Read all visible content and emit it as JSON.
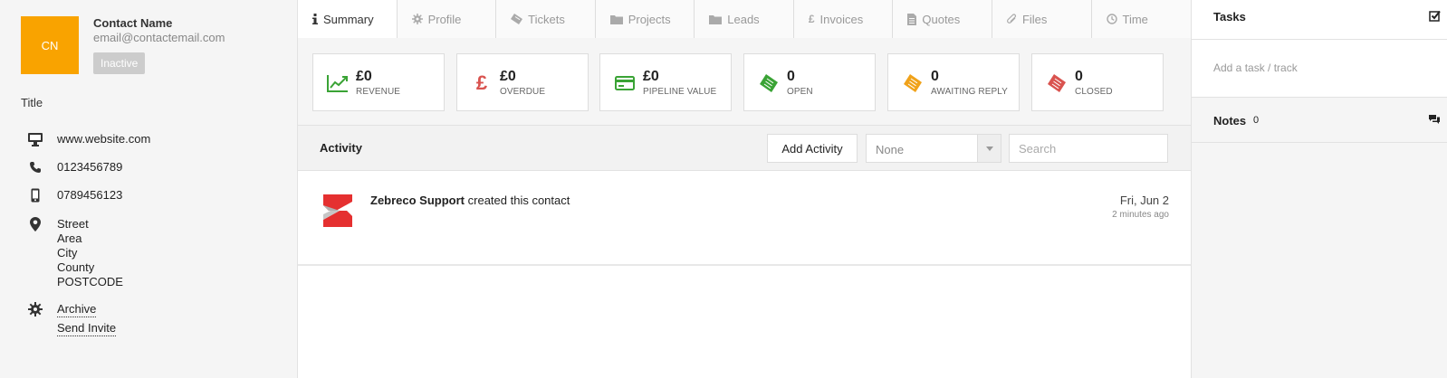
{
  "contact": {
    "initials": "CN",
    "name": "Contact Name",
    "email": "email@contactemail.com",
    "status": "Inactive",
    "title": "Title",
    "website": "www.website.com",
    "phone": "0123456789",
    "mobile": "0789456123",
    "address": [
      "Street",
      "Area",
      "City",
      "County",
      "POSTCODE"
    ],
    "actions": {
      "archive": "Archive",
      "send_invite": "Send Invite"
    },
    "avatar_color": "#f9a300"
  },
  "tabs": [
    {
      "label": "Summary",
      "icon": "info-icon",
      "active": true
    },
    {
      "label": "Profile",
      "icon": "gear-icon"
    },
    {
      "label": "Tickets",
      "icon": "ticket-icon"
    },
    {
      "label": "Projects",
      "icon": "folder-icon"
    },
    {
      "label": "Leads",
      "icon": "folder-icon"
    },
    {
      "label": "Invoices",
      "icon": "pound-icon"
    },
    {
      "label": "Quotes",
      "icon": "document-icon"
    },
    {
      "label": "Files",
      "icon": "paperclip-icon"
    },
    {
      "label": "Time",
      "icon": "clock-icon"
    }
  ],
  "stats": [
    {
      "value": "£0",
      "label": "REVENUE",
      "icon": "trend-up-icon",
      "color": "#3aa335"
    },
    {
      "value": "£0",
      "label": "OVERDUE",
      "icon": "pound-icon",
      "color": "#d9534f"
    },
    {
      "value": "£0",
      "label": "PIPELINE VALUE",
      "icon": "credit-card-icon",
      "color": "#3aa335"
    },
    {
      "value": "0",
      "label": "OPEN",
      "icon": "ticket-icon",
      "color": "#3aa335"
    },
    {
      "value": "0",
      "label": "AWAITING REPLY",
      "icon": "ticket-icon",
      "color": "#f0a21a"
    },
    {
      "value": "0",
      "label": "CLOSED",
      "icon": "ticket-icon",
      "color": "#d9534f"
    }
  ],
  "activity": {
    "title": "Activity",
    "add_button": "Add Activity",
    "filter_value": "None",
    "search_placeholder": "Search",
    "items": [
      {
        "actor": "Zebreco Support",
        "action": "created this contact",
        "date": "Fri, Jun 2",
        "ago": "2 minutes ago"
      }
    ]
  },
  "tasks": {
    "title": "Tasks",
    "add_placeholder": "Add a task / track"
  },
  "notes": {
    "title": "Notes",
    "count": "0"
  }
}
